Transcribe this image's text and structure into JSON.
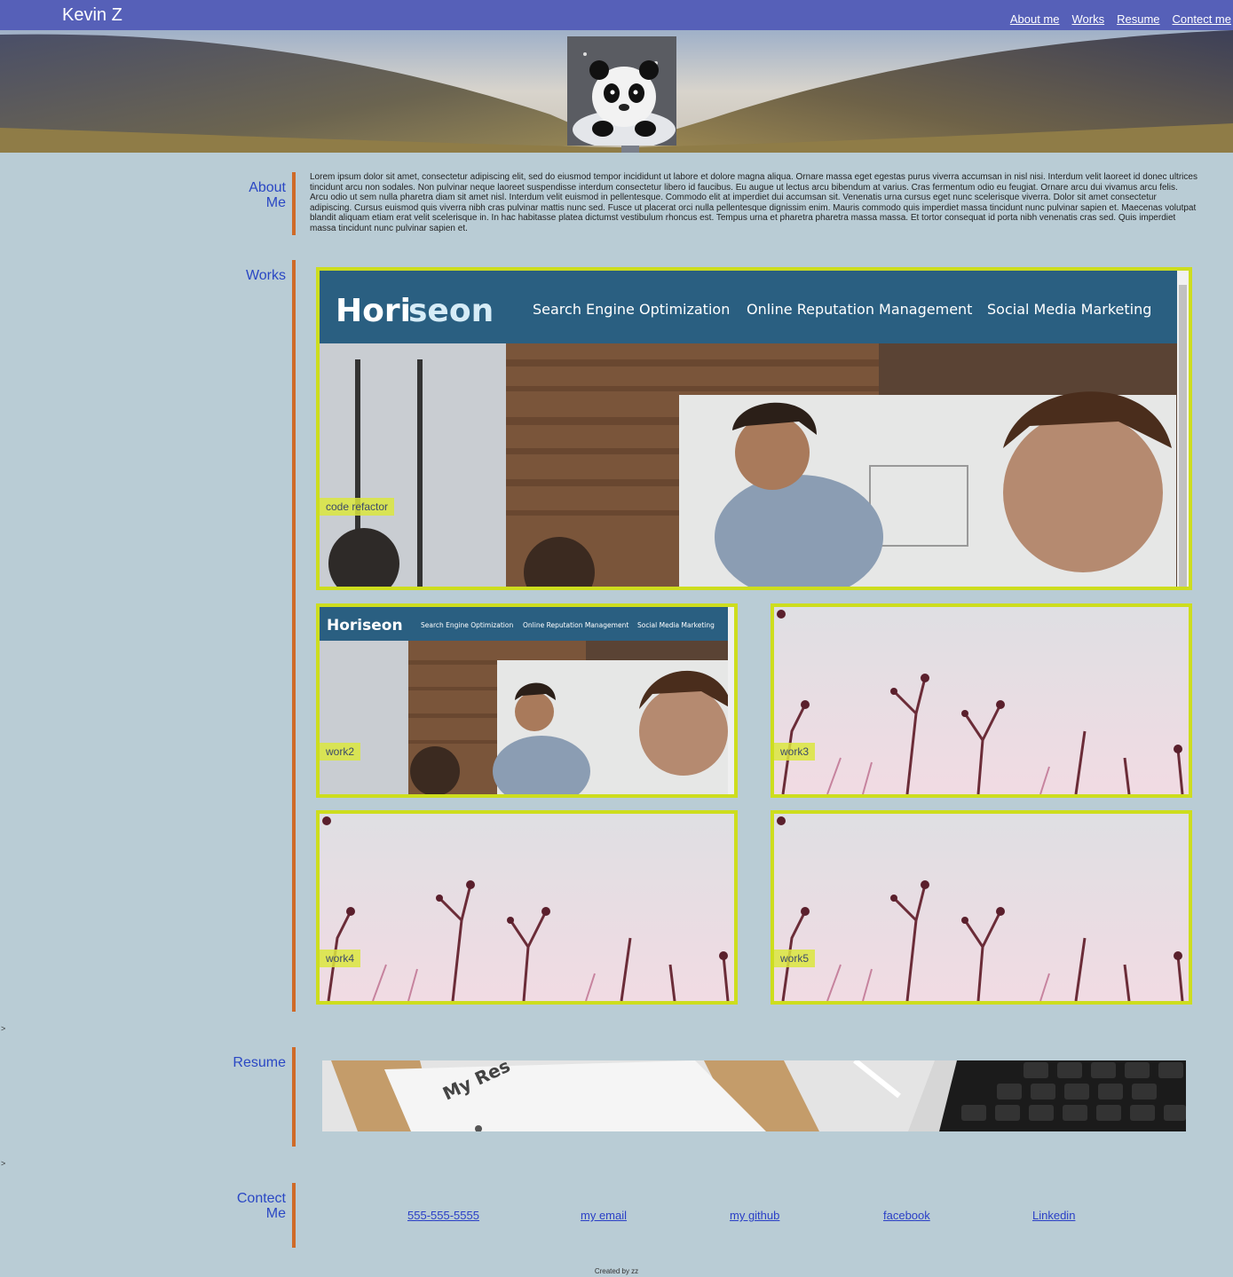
{
  "header": {
    "brand": "Kevin Z",
    "nav": [
      "About me",
      "Works",
      "Resume",
      "Contect me"
    ]
  },
  "about": {
    "heading_line1": "About",
    "heading_line2": "Me",
    "body": "Lorem ipsum dolor sit amet, consectetur adipiscing elit, sed do eiusmod tempor incididunt ut labore et dolore magna aliqua. Ornare massa eget egestas purus viverra accumsan in nisl nisi. Interdum velit laoreet id donec ultrices tincidunt arcu non sodales. Non pulvinar neque laoreet suspendisse interdum consectetur libero id faucibus. Eu augue ut lectus arcu bibendum at varius. Cras fermentum odio eu feugiat. Ornare arcu dui vivamus arcu felis. Arcu odio ut sem nulla pharetra diam sit amet nisl. Interdum velit euismod in pellentesque. Commodo elit at imperdiet dui accumsan sit. Venenatis urna cursus eget nunc scelerisque viverra. Dolor sit amet consectetur adipiscing. Cursus euismod quis viverra nibh cras pulvinar mattis nunc sed. Fusce ut placerat orci nulla pellentesque dignissim enim. Mauris commodo quis imperdiet massa tincidunt nunc pulvinar sapien et. Maecenas volutpat blandit aliquam etiam erat velit scelerisque in. In hac habitasse platea dictumst vestibulum rhoncus est. Tempus urna et pharetra pharetra massa massa. Et tortor consequat id porta nibh venenatis cras sed. Quis imperdiet massa tincidunt nunc pulvinar sapien et."
  },
  "works": {
    "heading": "Works",
    "items": [
      {
        "tag": "code refactor"
      },
      {
        "tag": "work2"
      },
      {
        "tag": "work3"
      },
      {
        "tag": "work4"
      },
      {
        "tag": "work5"
      }
    ],
    "preview": {
      "logo_a": "Hori",
      "logo_b": "seon",
      "logo_full": "Horiseon",
      "nav": [
        "Search Engine Optimization",
        "Online Reputation Management",
        "Social Media Marketing"
      ]
    }
  },
  "resume": {
    "heading": "Resume",
    "image_text": "My Res"
  },
  "contact": {
    "heading_line1": "Contect",
    "heading_line2": "Me",
    "links": [
      "555-555-5555",
      "my email",
      "my github",
      "facebook",
      "Linkedin"
    ]
  },
  "stray_marks": [
    ">",
    ">"
  ],
  "footer": "Created by zz",
  "colors": {
    "topbar": "#5660b8",
    "page_bg": "#b9ccd5",
    "accent_bar": "#cf6a28",
    "work_border": "#cddd1e",
    "heading": "#2a47c4"
  }
}
